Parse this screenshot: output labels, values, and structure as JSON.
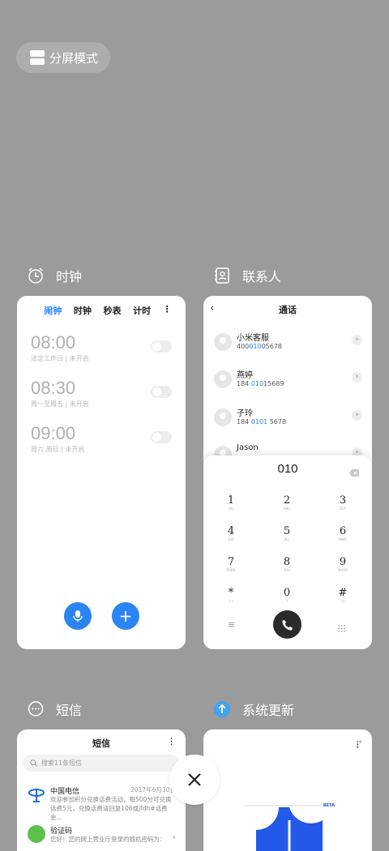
{
  "split_mode": {
    "label": "分屏模式"
  },
  "apps": {
    "clock": {
      "title": "时钟",
      "tabs": [
        "闹钟",
        "时钟",
        "秒表",
        "计时"
      ],
      "alarms": [
        {
          "time": "08:00",
          "desc": "法定工作日 | 未开启"
        },
        {
          "time": "08:30",
          "desc": "周一至周五 | 未开启"
        },
        {
          "time": "09:00",
          "desc": "周六 周日 | 未开启"
        }
      ]
    },
    "contacts": {
      "title": "联系人",
      "header": "通话",
      "entries": [
        {
          "name": "小米客服",
          "num_pre": "400",
          "num_hl": "010",
          "num_post": "05678"
        },
        {
          "name": "燕婷",
          "num_pre": "184 ",
          "num_hl": "010",
          "num_post": "15689"
        },
        {
          "name": "子玲",
          "num_pre": "184 ",
          "num_hl": "0101",
          "num_post": " 5678"
        },
        {
          "name": "Jason",
          "num_pre": "",
          "num_hl": "",
          "num_post": ""
        }
      ],
      "dial_input": "010",
      "keys": [
        {
          "d": "1",
          "l": "QU"
        },
        {
          "d": "2",
          "l": "ABC"
        },
        {
          "d": "3",
          "l": "DEF"
        },
        {
          "d": "4",
          "l": "GHI"
        },
        {
          "d": "5",
          "l": "JKL"
        },
        {
          "d": "6",
          "l": "MNO"
        },
        {
          "d": "7",
          "l": "PQRS"
        },
        {
          "d": "8",
          "l": "TUV"
        },
        {
          "d": "9",
          "l": "WXYZ"
        },
        {
          "d": "*",
          "l": "(,)"
        },
        {
          "d": "0",
          "l": "+"
        },
        {
          "d": "#",
          "l": "(;)"
        }
      ]
    },
    "messages": {
      "title": "短信",
      "header": "短信",
      "search_placeholder": "搜索11条短信",
      "threads": [
        {
          "sender": "中国电信",
          "date": "2017年6月30日",
          "body": "欢迎参加积分兑换话费活动，每500分可兑换话费5元，兑换话费请回复106或jfdh#话费金..."
        },
        {
          "sender": "验证码",
          "date": "",
          "body": "您好！您的网上营业厅登录的随机密码为："
        }
      ]
    },
    "system_update": {
      "title": "系统更新",
      "badge": "BETA"
    }
  },
  "colors": {
    "accent": "#2a84f2",
    "background": "#9b9b9b"
  }
}
